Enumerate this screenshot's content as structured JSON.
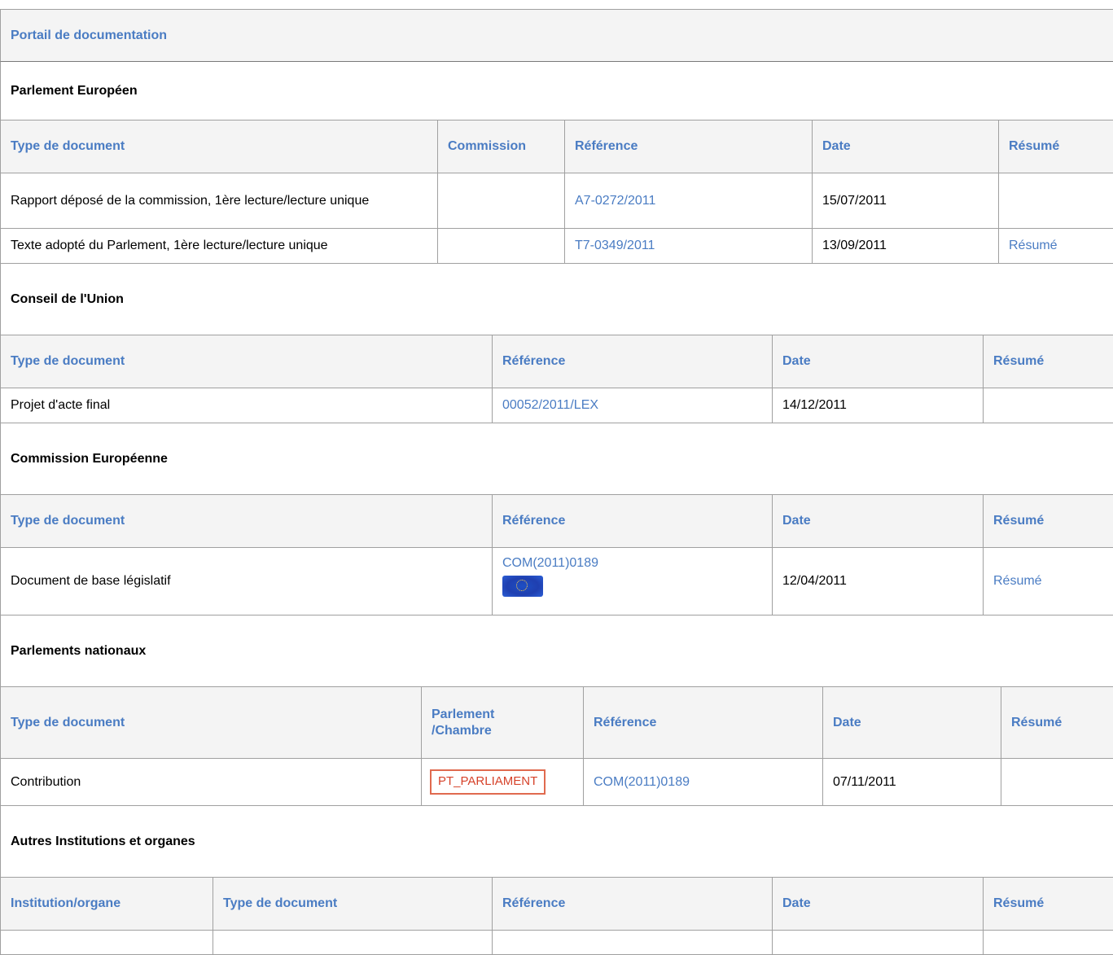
{
  "portal": {
    "title": "Portail de documentation"
  },
  "ep": {
    "title": "Parlement Européen",
    "headers": {
      "type": "Type de document",
      "committee": "Commission",
      "reference": "Référence",
      "date": "Date",
      "summary": "Résumé"
    },
    "rows": [
      {
        "type": "Rapport déposé de la commission, 1ère lecture/lecture unique",
        "committee": "",
        "reference": "A7-0272/2011",
        "date": "15/07/2011",
        "summary": ""
      },
      {
        "type": "Texte adopté du Parlement, 1ère lecture/lecture unique",
        "committee": "",
        "reference": "T7-0349/2011",
        "date": "13/09/2011",
        "summary": "Résumé"
      }
    ]
  },
  "council": {
    "title": "Conseil de l'Union",
    "headers": {
      "type": "Type de document",
      "reference": "Référence",
      "date": "Date",
      "summary": "Résumé"
    },
    "rows": [
      {
        "type": "Projet d'acte final",
        "reference": "00052/2011/LEX",
        "date": "14/12/2011",
        "summary": ""
      }
    ]
  },
  "commission": {
    "title": "Commission Européenne",
    "headers": {
      "type": "Type de document",
      "reference": "Référence",
      "date": "Date",
      "summary": "Résumé"
    },
    "rows": [
      {
        "type": "Document de base législatif",
        "reference": "COM(2011)0189",
        "reference_icon": "eu-flag-icon",
        "date": "12/04/2011",
        "summary": "Résumé"
      }
    ]
  },
  "national": {
    "title": "Parlements nationaux",
    "headers": {
      "type": "Type de document",
      "chamber_line1": "Parlement",
      "chamber_line2": "/Chambre",
      "reference": "Référence",
      "date": "Date",
      "summary": "Résumé"
    },
    "rows": [
      {
        "type": "Contribution",
        "chamber": "PT_PARLIAMENT",
        "reference": "COM(2011)0189",
        "date": "07/11/2011",
        "summary": ""
      }
    ]
  },
  "others": {
    "title": "Autres Institutions et organes",
    "headers": {
      "institution": "Institution/organe",
      "type": "Type de document",
      "reference": "Référence",
      "date": "Date",
      "summary": "Résumé"
    }
  },
  "colors": {
    "link": "#4a7cc3",
    "header_bg": "#f4f4f4",
    "badge": "#d6422a"
  }
}
